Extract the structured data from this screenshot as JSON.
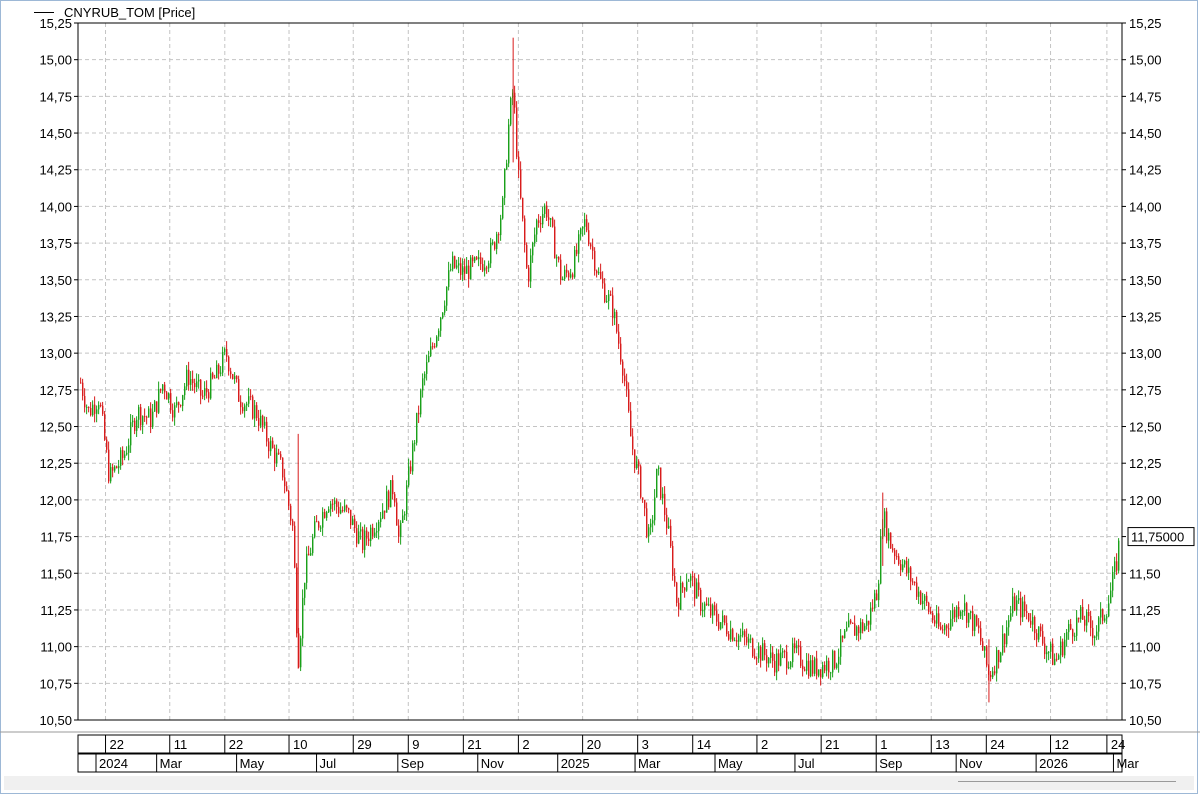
{
  "legend": {
    "label": "CNYRUB_TOM [Price]"
  },
  "last_price_label": "11,75000",
  "chart_data": {
    "type": "candlestick",
    "series_name": "CNYRUB_TOM [Price]",
    "ylim": [
      10.5,
      15.25
    ],
    "grid": true,
    "y_ticks": [
      "10,50",
      "10,75",
      "11,00",
      "11,25",
      "11,50",
      "11,75",
      "12,00",
      "12,25",
      "12,50",
      "12,75",
      "13,00",
      "13,25",
      "13,50",
      "13,75",
      "14,00",
      "14,25",
      "14,50",
      "14,75",
      "15,00",
      "15,25"
    ],
    "x_top_ticks": [
      "22",
      "11",
      "22",
      "10",
      "29",
      "9",
      "21",
      "2",
      "20",
      "3",
      "14",
      "2",
      "21",
      "1",
      "13",
      "24",
      "12",
      "24"
    ],
    "x_bottom_ticks": [
      "2024",
      "Mar",
      "May",
      "Jul",
      "Sep",
      "Nov",
      "2025",
      "Mar",
      "May",
      "Jul",
      "Sep",
      "Nov",
      "2026",
      "Mar"
    ],
    "price_path": [
      [
        "2024-01-03",
        12.8
      ],
      [
        "2024-01-09",
        12.6
      ],
      [
        "2024-01-17",
        12.7
      ],
      [
        "2024-01-25",
        12.15
      ],
      [
        "2024-02-05",
        12.3
      ],
      [
        "2024-02-15",
        12.6
      ],
      [
        "2024-02-26",
        12.55
      ],
      [
        "2024-03-06",
        12.8
      ],
      [
        "2024-03-15",
        12.6
      ],
      [
        "2024-03-25",
        12.85
      ],
      [
        "2024-04-05",
        12.7
      ],
      [
        "2024-04-16",
        12.85
      ],
      [
        "2024-04-23",
        13.0
      ],
      [
        "2024-05-03",
        12.7
      ],
      [
        "2024-05-16",
        12.6
      ],
      [
        "2024-05-25",
        12.4
      ],
      [
        "2024-06-05",
        12.2
      ],
      [
        "2024-06-13",
        11.8
      ],
      [
        "2024-06-17",
        10.9
      ],
      [
        "2024-06-22",
        11.5
      ],
      [
        "2024-06-30",
        11.8
      ],
      [
        "2024-07-10",
        12.0
      ],
      [
        "2024-07-25",
        11.9
      ],
      [
        "2024-08-05",
        11.7
      ],
      [
        "2024-08-18",
        11.9
      ],
      [
        "2024-08-29",
        12.1
      ],
      [
        "2024-09-02",
        11.7
      ],
      [
        "2024-09-10",
        12.2
      ],
      [
        "2024-09-20",
        12.8
      ],
      [
        "2024-10-02",
        13.2
      ],
      [
        "2024-10-12",
        13.6
      ],
      [
        "2024-10-20",
        13.55
      ],
      [
        "2024-11-02",
        13.6
      ],
      [
        "2024-11-12",
        13.7
      ],
      [
        "2024-11-20",
        14.0
      ],
      [
        "2024-11-25",
        14.6
      ],
      [
        "2024-11-28",
        14.8
      ],
      [
        "2024-12-02",
        14.2
      ],
      [
        "2024-12-09",
        13.5
      ],
      [
        "2024-12-16",
        13.9
      ],
      [
        "2024-12-23",
        14.0
      ],
      [
        "2025-01-04",
        13.5
      ],
      [
        "2025-01-13",
        13.6
      ],
      [
        "2025-01-22",
        13.9
      ],
      [
        "2025-02-02",
        13.5
      ],
      [
        "2025-02-12",
        13.3
      ],
      [
        "2025-02-20",
        12.9
      ],
      [
        "2025-02-26",
        12.4
      ],
      [
        "2025-03-05",
        12.1
      ],
      [
        "2025-03-12",
        11.7
      ],
      [
        "2025-03-18",
        12.2
      ],
      [
        "2025-03-26",
        11.8
      ],
      [
        "2025-04-02",
        11.3
      ],
      [
        "2025-04-10",
        11.5
      ],
      [
        "2025-04-20",
        11.3
      ],
      [
        "2025-05-01",
        11.2
      ],
      [
        "2025-05-15",
        11.1
      ],
      [
        "2025-05-30",
        11.0
      ],
      [
        "2025-06-15",
        10.9
      ],
      [
        "2025-07-01",
        10.95
      ],
      [
        "2025-07-15",
        10.85
      ],
      [
        "2025-07-31",
        10.9
      ],
      [
        "2025-08-10",
        11.1
      ],
      [
        "2025-08-25",
        11.15
      ],
      [
        "2025-09-02",
        11.4
      ],
      [
        "2025-09-06",
        11.9
      ],
      [
        "2025-09-12",
        11.7
      ],
      [
        "2025-09-25",
        11.5
      ],
      [
        "2025-10-08",
        11.3
      ],
      [
        "2025-10-20",
        11.1
      ],
      [
        "2025-11-05",
        11.3
      ],
      [
        "2025-11-18",
        11.1
      ],
      [
        "2025-11-26",
        10.8
      ],
      [
        "2025-12-05",
        11.0
      ],
      [
        "2025-12-15",
        11.3
      ],
      [
        "2025-12-28",
        11.2
      ],
      [
        "2026-01-08",
        11.0
      ],
      [
        "2026-01-16",
        10.9
      ],
      [
        "2026-01-25",
        11.1
      ],
      [
        "2026-02-05",
        11.2
      ],
      [
        "2026-02-15",
        11.1
      ],
      [
        "2026-02-25",
        11.3
      ],
      [
        "2026-03-03",
        11.55
      ],
      [
        "2026-03-06",
        11.75
      ]
    ],
    "last_value": 11.75
  }
}
